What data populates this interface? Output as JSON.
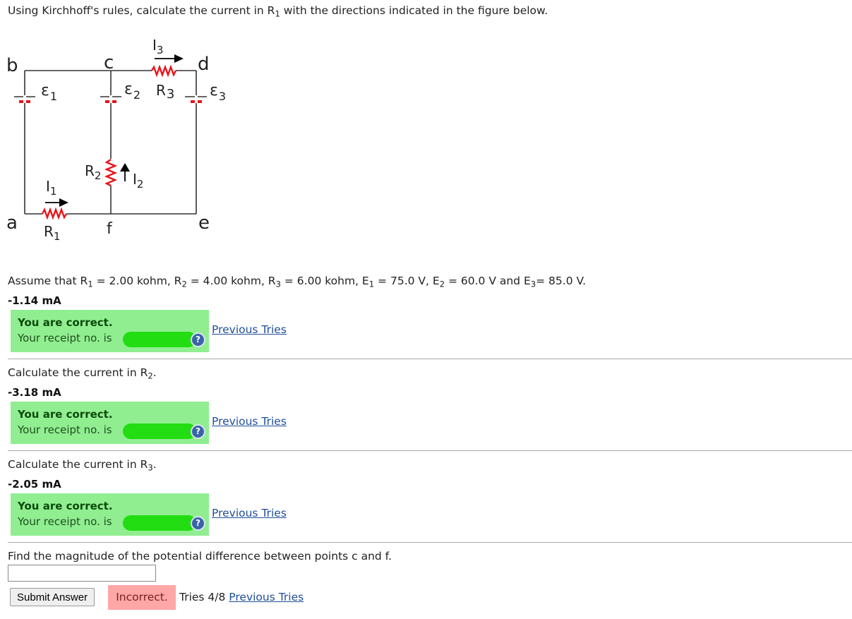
{
  "intro": {
    "before": "Using Kirchhoff's rules, calculate the current in R",
    "sub": "1",
    "after": " with the directions indicated in the figure below."
  },
  "circuit": {
    "labels": {
      "b": "b",
      "c": "c",
      "d": "d",
      "a": "a",
      "f": "f",
      "e": "e",
      "e1": "ε",
      "e1_sub": "1",
      "e2": "ε",
      "e2_sub": "2",
      "e3": "ε",
      "e3_sub": "3",
      "r1": "R",
      "r1_sub": "1",
      "r2": "R",
      "r2_sub": "2",
      "r3": "R",
      "r3_sub": "3",
      "i1": "I",
      "i1_sub": "1",
      "i2": "I",
      "i2_sub": "2",
      "i3": "I",
      "i3_sub": "3"
    },
    "colors": {
      "wire": "#333333",
      "resistor": "#e8141b",
      "battery_plate": "#e8141b",
      "arrow": "#000000"
    }
  },
  "assume": {
    "prefix": "Assume that R",
    "r1_sub": "1",
    "r1_val": " = 2.00 kohm, R",
    "r2_sub": "2",
    "r2_val": " = 4.00 kohm, R",
    "r3_sub": "3",
    "r3_val": " = 6.00 kohm, E",
    "e1_sub": "1",
    "e1_val": " = 75.0 V, E",
    "e2_sub": "2",
    "e2_val": " = 60.0 V and E",
    "e3_sub": "3",
    "e3_val": "= 85.0 V."
  },
  "parts": [
    {
      "answer": "-1.14 mA",
      "feedback_title": "You are correct.",
      "receipt_label": "Your receipt no. is",
      "help_icon": "?",
      "previous_tries": "Previous Tries"
    },
    {
      "question_before": "Calculate the current in R",
      "question_sub": "2",
      "question_after": ".",
      "answer": "-3.18 mA",
      "feedback_title": "You are correct.",
      "receipt_label": "Your receipt no. is",
      "help_icon": "?",
      "previous_tries": "Previous Tries"
    },
    {
      "question_before": "Calculate the current in R",
      "question_sub": "3",
      "question_after": ".",
      "answer": "-2.05 mA",
      "feedback_title": "You are correct.",
      "receipt_label": "Your receipt no. is",
      "help_icon": "?",
      "previous_tries": "Previous Tries"
    }
  ],
  "final_part": {
    "question": "Find the magnitude of the potential difference between points c and f.",
    "input_value": "",
    "submit_label": "Submit Answer",
    "status": "Incorrect.",
    "tries": "Tries 4/8",
    "previous_tries": "Previous Tries"
  },
  "colors": {
    "correct_bg": "#90ee90",
    "incorrect_bg": "#ffa7a7",
    "redaction": "#22dd11",
    "link": "#1f4e99"
  }
}
